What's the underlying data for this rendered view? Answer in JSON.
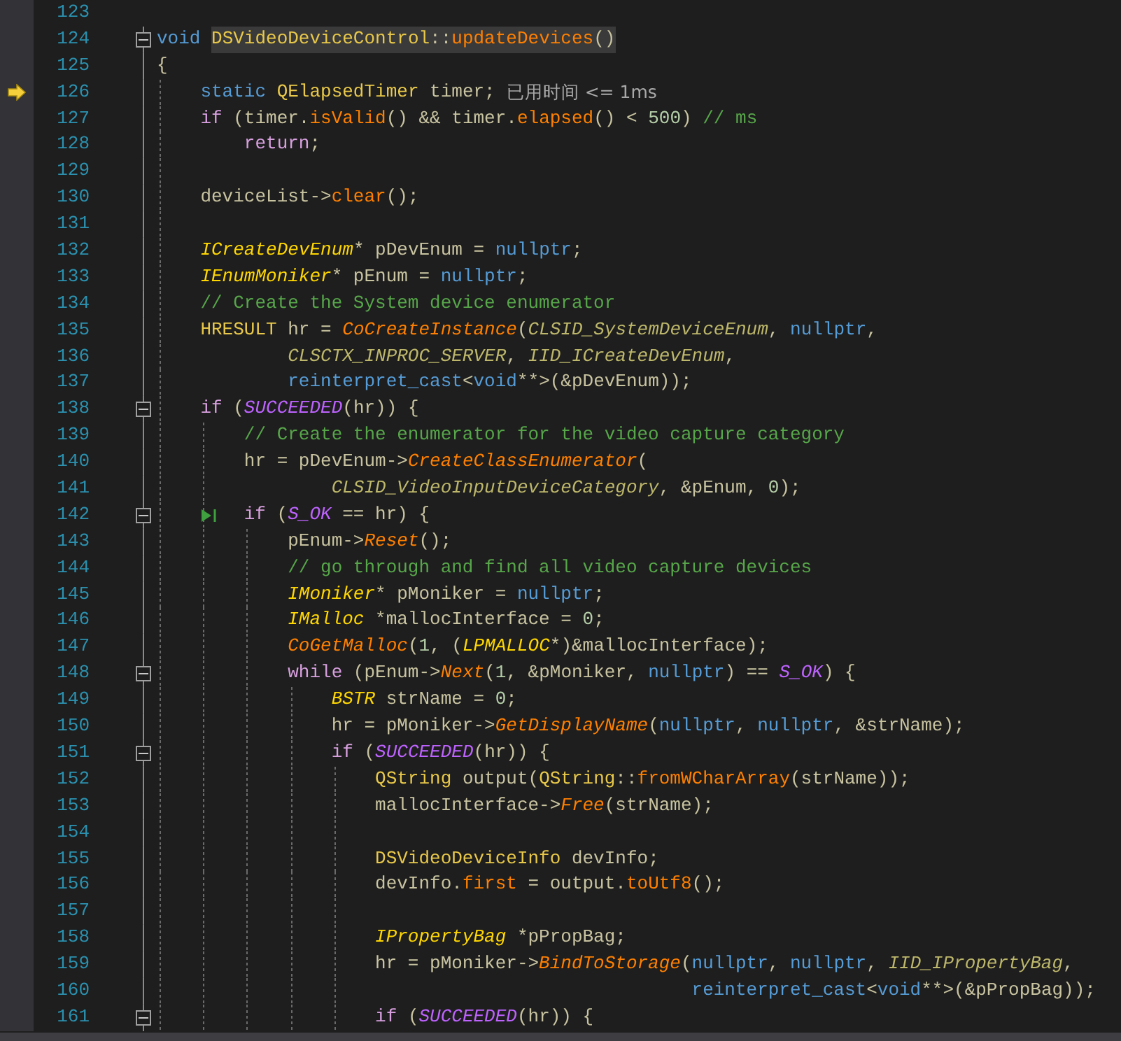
{
  "editor": {
    "lines": [
      {
        "number": "123",
        "current": false
      },
      {
        "number": "124",
        "current": false,
        "fold_toggle": {
          "expanded": true
        },
        "tokens": [
          {
            "kind": "keyword",
            "text": "void "
          },
          {
            "kind": "type",
            "text": "DSVideoDeviceControl",
            "highlighted": true
          },
          {
            "kind": "plain",
            "text": "::",
            "highlighted": true
          },
          {
            "kind": "function",
            "text": "updateDevices",
            "highlighted": true
          },
          {
            "kind": "plain",
            "text": "()",
            "highlighted": true
          }
        ]
      },
      {
        "number": "125",
        "current": false,
        "tokens": [
          {
            "kind": "plain",
            "text": "{"
          }
        ]
      },
      {
        "number": "126",
        "current": true,
        "tokens": [
          {
            "kind": "keyword",
            "text": "    static "
          },
          {
            "kind": "type",
            "text": "QElapsedTimer"
          },
          {
            "kind": "plain",
            "text": " timer;"
          },
          {
            "kind": "hint",
            "text": "已用时间 <= 1ms"
          }
        ]
      },
      {
        "number": "127",
        "current": false,
        "tokens": [
          {
            "kind": "control",
            "text": "    if"
          },
          {
            "kind": "plain",
            "text": " (timer."
          },
          {
            "kind": "function",
            "text": "isValid"
          },
          {
            "kind": "plain",
            "text": "() && timer."
          },
          {
            "kind": "function",
            "text": "elapsed"
          },
          {
            "kind": "plain",
            "text": "() < "
          },
          {
            "kind": "number",
            "text": "500"
          },
          {
            "kind": "plain",
            "text": ") "
          },
          {
            "kind": "comment",
            "text": "// ms"
          }
        ]
      },
      {
        "number": "128",
        "current": false,
        "tokens": [
          {
            "kind": "control",
            "text": "        return"
          },
          {
            "kind": "plain",
            "text": ";"
          }
        ]
      },
      {
        "number": "129",
        "current": false
      },
      {
        "number": "130",
        "current": false,
        "tokens": [
          {
            "kind": "plain",
            "text": "    deviceList->"
          },
          {
            "kind": "function",
            "text": "clear"
          },
          {
            "kind": "plain",
            "text": "();"
          }
        ]
      },
      {
        "number": "131",
        "current": false
      },
      {
        "number": "132",
        "current": false,
        "tokens": [
          {
            "kind": "itype",
            "text": "    ICreateDevEnum"
          },
          {
            "kind": "plain",
            "text": "* pDevEnum = "
          },
          {
            "kind": "keyword",
            "text": "nullptr"
          },
          {
            "kind": "plain",
            "text": ";"
          }
        ]
      },
      {
        "number": "133",
        "current": false,
        "tokens": [
          {
            "kind": "itype",
            "text": "    IEnumMoniker"
          },
          {
            "kind": "plain",
            "text": "* pEnum = "
          },
          {
            "kind": "keyword",
            "text": "nullptr"
          },
          {
            "kind": "plain",
            "text": ";"
          }
        ]
      },
      {
        "number": "134",
        "current": false,
        "tokens": [
          {
            "kind": "comment",
            "text": "    // Create the System device enumerator"
          }
        ]
      },
      {
        "number": "135",
        "current": false,
        "tokens": [
          {
            "kind": "type",
            "text": "    HRESULT"
          },
          {
            "kind": "plain",
            "text": " hr = "
          },
          {
            "kind": "ifunction",
            "text": "CoCreateInstance"
          },
          {
            "kind": "plain",
            "text": "("
          },
          {
            "kind": "constant",
            "text": "CLSID_SystemDeviceEnum"
          },
          {
            "kind": "plain",
            "text": ", "
          },
          {
            "kind": "keyword",
            "text": "nullptr"
          },
          {
            "kind": "plain",
            "text": ","
          }
        ]
      },
      {
        "number": "136",
        "current": false,
        "tokens": [
          {
            "kind": "constant",
            "text": "            CLSCTX_INPROC_SERVER"
          },
          {
            "kind": "plain",
            "text": ", "
          },
          {
            "kind": "constant",
            "text": "IID_ICreateDevEnum"
          },
          {
            "kind": "plain",
            "text": ","
          }
        ]
      },
      {
        "number": "137",
        "current": false,
        "tokens": [
          {
            "kind": "keyword",
            "text": "            reinterpret_cast"
          },
          {
            "kind": "plain",
            "text": "<"
          },
          {
            "kind": "keyword",
            "text": "void"
          },
          {
            "kind": "plain",
            "text": "**>(&pDevEnum));"
          }
        ]
      },
      {
        "number": "138",
        "current": false,
        "fold_toggle": {
          "expanded": true
        },
        "tokens": [
          {
            "kind": "control",
            "text": "    if"
          },
          {
            "kind": "plain",
            "text": " ("
          },
          {
            "kind": "macro",
            "text": "SUCCEEDED"
          },
          {
            "kind": "plain",
            "text": "(hr)) {"
          }
        ]
      },
      {
        "number": "139",
        "current": false,
        "tokens": [
          {
            "kind": "comment",
            "text": "        // Create the enumerator for the video capture category"
          }
        ]
      },
      {
        "number": "140",
        "current": false,
        "tokens": [
          {
            "kind": "plain",
            "text": "        hr = pDevEnum->"
          },
          {
            "kind": "ifunction",
            "text": "CreateClassEnumerator"
          },
          {
            "kind": "plain",
            "text": "("
          }
        ]
      },
      {
        "number": "141",
        "current": false,
        "tokens": [
          {
            "kind": "constant",
            "text": "                CLSID_VideoInputDeviceCategory"
          },
          {
            "kind": "plain",
            "text": ", &pEnum, "
          },
          {
            "kind": "number",
            "text": "0"
          },
          {
            "kind": "plain",
            "text": ");"
          }
        ]
      },
      {
        "number": "142",
        "current": false,
        "fold_toggle": {
          "expanded": true
        },
        "tokens": [
          {
            "kind": "run_icon"
          },
          {
            "kind": "control",
            "text": "if"
          },
          {
            "kind": "plain",
            "text": " ("
          },
          {
            "kind": "macro",
            "text": "S_OK"
          },
          {
            "kind": "plain",
            "text": " == hr) {"
          }
        ]
      },
      {
        "number": "143",
        "current": false,
        "tokens": [
          {
            "kind": "plain",
            "text": "            pEnum->"
          },
          {
            "kind": "ifunction",
            "text": "Reset"
          },
          {
            "kind": "plain",
            "text": "();"
          }
        ]
      },
      {
        "number": "144",
        "current": false,
        "tokens": [
          {
            "kind": "comment",
            "text": "            // go through and find all video capture devices"
          }
        ]
      },
      {
        "number": "145",
        "current": false,
        "tokens": [
          {
            "kind": "itype",
            "text": "            IMoniker"
          },
          {
            "kind": "plain",
            "text": "* pMoniker = "
          },
          {
            "kind": "keyword",
            "text": "nullptr"
          },
          {
            "kind": "plain",
            "text": ";"
          }
        ]
      },
      {
        "number": "146",
        "current": false,
        "tokens": [
          {
            "kind": "itype",
            "text": "            IMalloc"
          },
          {
            "kind": "plain",
            "text": " *mallocInterface = "
          },
          {
            "kind": "number",
            "text": "0"
          },
          {
            "kind": "plain",
            "text": ";"
          }
        ]
      },
      {
        "number": "147",
        "current": false,
        "tokens": [
          {
            "kind": "ifunction",
            "text": "            CoGetMalloc"
          },
          {
            "kind": "plain",
            "text": "("
          },
          {
            "kind": "number",
            "text": "1"
          },
          {
            "kind": "plain",
            "text": ", ("
          },
          {
            "kind": "itype",
            "text": "LPMALLOC"
          },
          {
            "kind": "plain",
            "text": "*)&mallocInterface);"
          }
        ]
      },
      {
        "number": "148",
        "current": false,
        "fold_toggle": {
          "expanded": true
        },
        "tokens": [
          {
            "kind": "control",
            "text": "            while"
          },
          {
            "kind": "plain",
            "text": " (pEnum->"
          },
          {
            "kind": "ifunction",
            "text": "Next"
          },
          {
            "kind": "plain",
            "text": "("
          },
          {
            "kind": "number",
            "text": "1"
          },
          {
            "kind": "plain",
            "text": ", &pMoniker, "
          },
          {
            "kind": "keyword",
            "text": "nullptr"
          },
          {
            "kind": "plain",
            "text": ") == "
          },
          {
            "kind": "macro",
            "text": "S_OK"
          },
          {
            "kind": "plain",
            "text": ") {"
          }
        ]
      },
      {
        "number": "149",
        "current": false,
        "tokens": [
          {
            "kind": "itype",
            "text": "                BSTR"
          },
          {
            "kind": "plain",
            "text": " strName = "
          },
          {
            "kind": "number",
            "text": "0"
          },
          {
            "kind": "plain",
            "text": ";"
          }
        ]
      },
      {
        "number": "150",
        "current": false,
        "tokens": [
          {
            "kind": "plain",
            "text": "                hr = pMoniker->"
          },
          {
            "kind": "ifunction",
            "text": "GetDisplayName"
          },
          {
            "kind": "plain",
            "text": "("
          },
          {
            "kind": "keyword",
            "text": "nullptr"
          },
          {
            "kind": "plain",
            "text": ", "
          },
          {
            "kind": "keyword",
            "text": "nullptr"
          },
          {
            "kind": "plain",
            "text": ", &strName);"
          }
        ]
      },
      {
        "number": "151",
        "current": false,
        "fold_toggle": {
          "expanded": true
        },
        "tokens": [
          {
            "kind": "control",
            "text": "                if"
          },
          {
            "kind": "plain",
            "text": " ("
          },
          {
            "kind": "macro",
            "text": "SUCCEEDED"
          },
          {
            "kind": "plain",
            "text": "(hr)) {"
          }
        ]
      },
      {
        "number": "152",
        "current": false,
        "tokens": [
          {
            "kind": "type",
            "text": "                    QString"
          },
          {
            "kind": "plain",
            "text": " output("
          },
          {
            "kind": "type",
            "text": "QString"
          },
          {
            "kind": "plain",
            "text": "::"
          },
          {
            "kind": "function",
            "text": "fromWCharArray"
          },
          {
            "kind": "plain",
            "text": "(strName));"
          }
        ]
      },
      {
        "number": "153",
        "current": false,
        "tokens": [
          {
            "kind": "plain",
            "text": "                    mallocInterface->"
          },
          {
            "kind": "ifunction",
            "text": "Free"
          },
          {
            "kind": "plain",
            "text": "(strName);"
          }
        ]
      },
      {
        "number": "154",
        "current": false
      },
      {
        "number": "155",
        "current": false,
        "tokens": [
          {
            "kind": "type",
            "text": "                    DSVideoDeviceInfo"
          },
          {
            "kind": "plain",
            "text": " devInfo;"
          }
        ]
      },
      {
        "number": "156",
        "current": false,
        "tokens": [
          {
            "kind": "plain",
            "text": "                    devInfo."
          },
          {
            "kind": "function",
            "text": "first"
          },
          {
            "kind": "plain",
            "text": " = output."
          },
          {
            "kind": "function",
            "text": "toUtf8"
          },
          {
            "kind": "plain",
            "text": "();"
          }
        ]
      },
      {
        "number": "157",
        "current": false
      },
      {
        "number": "158",
        "current": false,
        "tokens": [
          {
            "kind": "itype",
            "text": "                    IPropertyBag"
          },
          {
            "kind": "plain",
            "text": " *pPropBag;"
          }
        ]
      },
      {
        "number": "159",
        "current": false,
        "tokens": [
          {
            "kind": "plain",
            "text": "                    hr = pMoniker->"
          },
          {
            "kind": "ifunction",
            "text": "BindToStorage"
          },
          {
            "kind": "plain",
            "text": "("
          },
          {
            "kind": "keyword",
            "text": "nullptr"
          },
          {
            "kind": "plain",
            "text": ", "
          },
          {
            "kind": "keyword",
            "text": "nullptr"
          },
          {
            "kind": "plain",
            "text": ", "
          },
          {
            "kind": "constant",
            "text": "IID_IPropertyBag"
          },
          {
            "kind": "plain",
            "text": ","
          }
        ]
      },
      {
        "number": "160",
        "current": false,
        "tokens": [
          {
            "kind": "keyword",
            "text": "                                                 reinterpret_cast"
          },
          {
            "kind": "plain",
            "text": "<"
          },
          {
            "kind": "keyword",
            "text": "void"
          },
          {
            "kind": "plain",
            "text": "**>(&pPropBag));"
          }
        ]
      },
      {
        "number": "161",
        "current": false,
        "fold_toggle": {
          "expanded": true
        },
        "tokens": [
          {
            "kind": "control",
            "text": "                    if"
          },
          {
            "kind": "plain",
            "text": " ("
          },
          {
            "kind": "macro",
            "text": "SUCCEEDED"
          },
          {
            "kind": "plain",
            "text": "(hr)) {"
          }
        ]
      }
    ]
  }
}
